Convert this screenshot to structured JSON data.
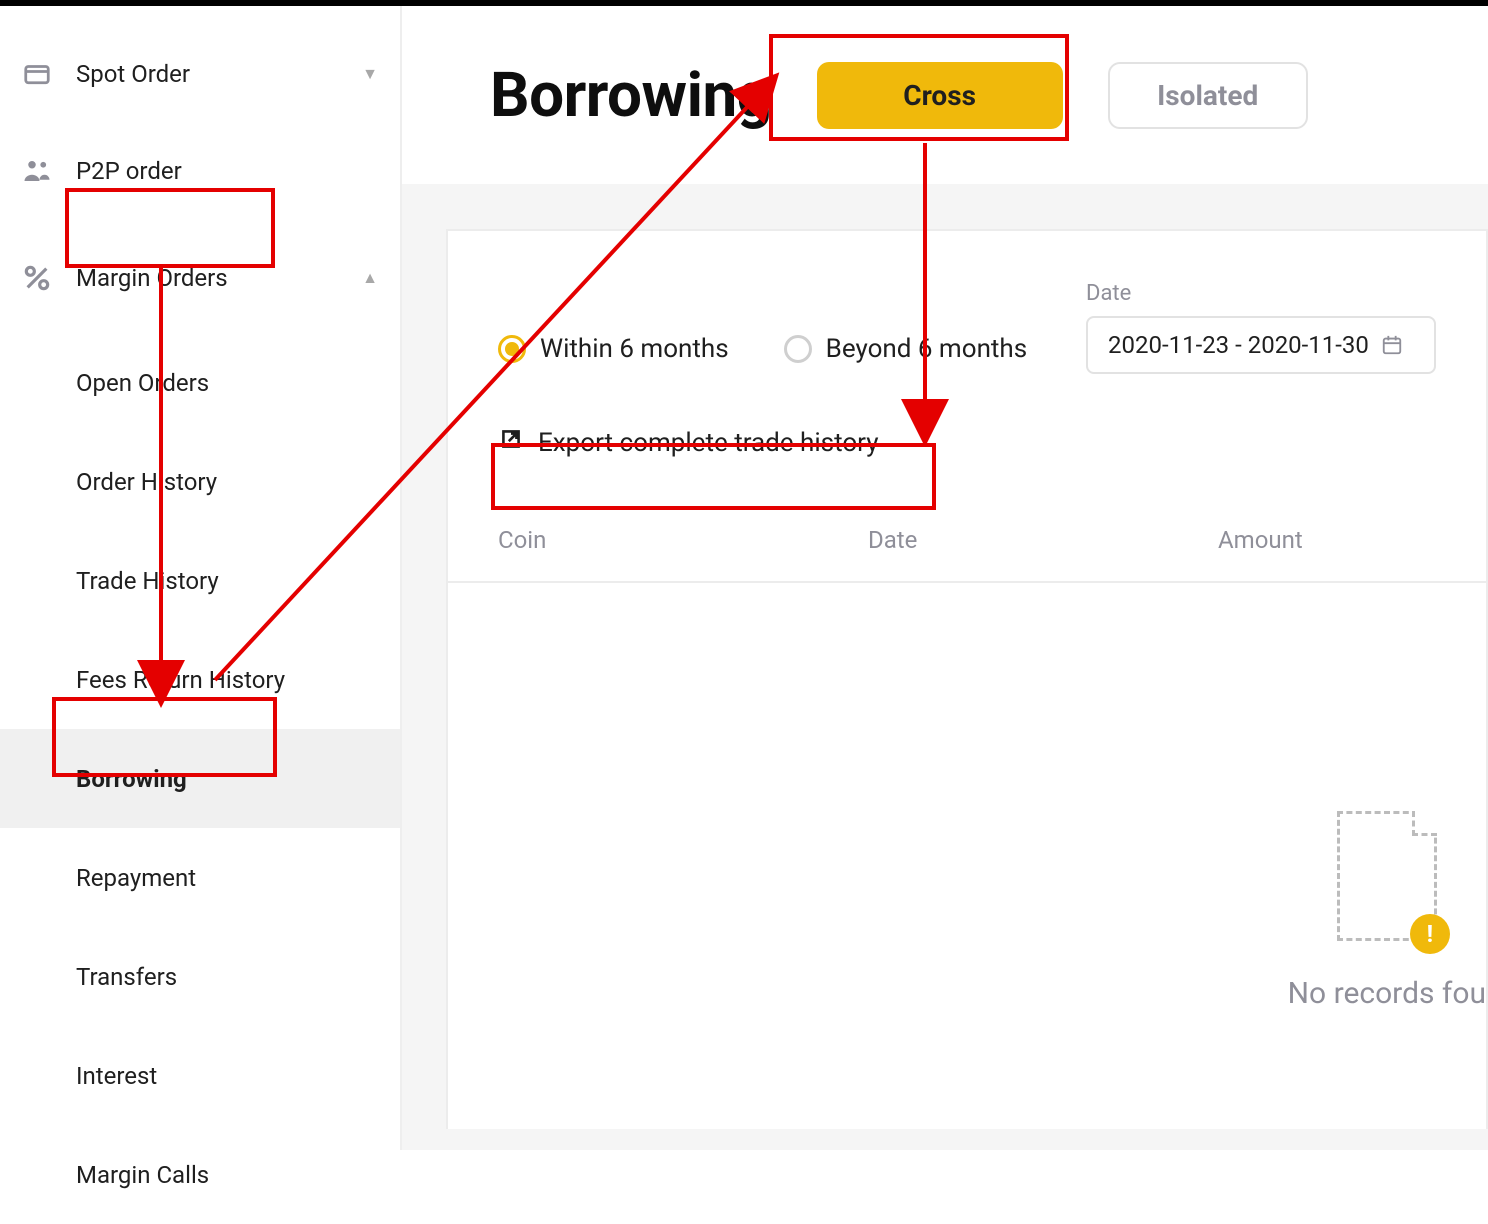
{
  "sidebar": {
    "spot_order": "Spot Order",
    "p2p_order": "P2P order",
    "margin_orders": "Margin Orders",
    "submenu": {
      "open_orders": "Open Orders",
      "order_history": "Order History",
      "trade_history": "Trade History",
      "fees_return_history": "Fees Return History",
      "borrowing": "Borrowing",
      "repayment": "Repayment",
      "transfers": "Transfers",
      "interest": "Interest",
      "margin_calls": "Margin Calls"
    }
  },
  "header": {
    "title": "Borrowing",
    "tab_cross": "Cross",
    "tab_isolated": "Isolated"
  },
  "filters": {
    "within_6_months": "Within 6 months",
    "beyond_6_months": "Beyond 6 months",
    "date_label": "Date",
    "date_range": "2020-11-23 - 2020-11-30"
  },
  "export_link": "Export complete trade history",
  "table": {
    "col_coin": "Coin",
    "col_date": "Date",
    "col_amount": "Amount"
  },
  "empty_state": "No records fou"
}
